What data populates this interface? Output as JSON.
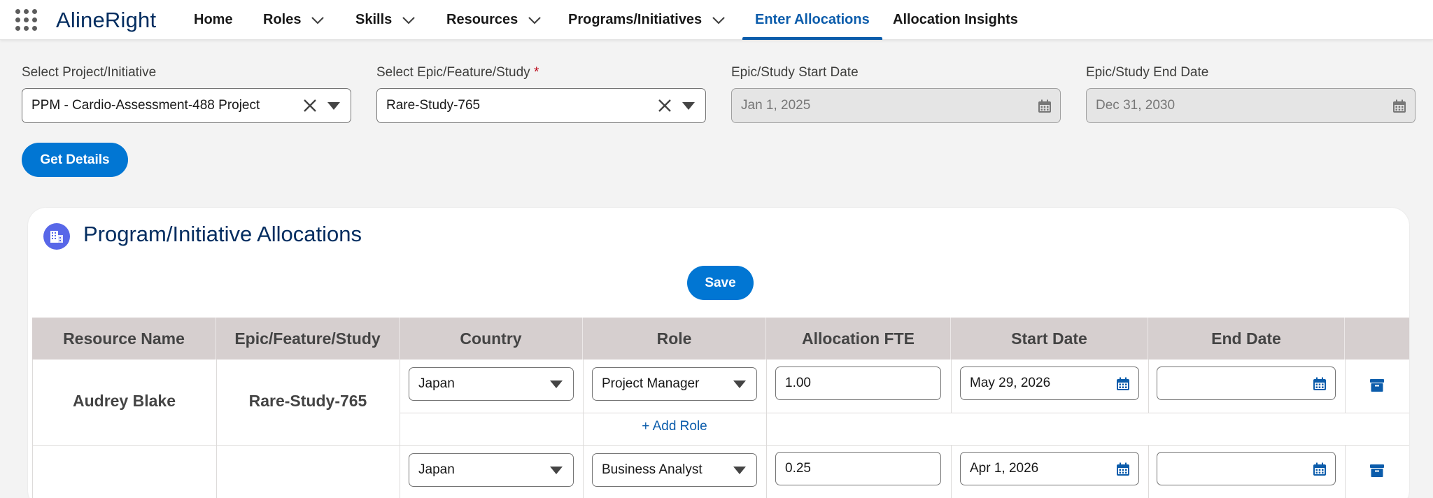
{
  "app": {
    "name": "AlineRight"
  },
  "nav": {
    "items": [
      {
        "label": "Home",
        "has_menu": false
      },
      {
        "label": "Roles",
        "has_menu": true
      },
      {
        "label": "Skills",
        "has_menu": true
      },
      {
        "label": "Resources",
        "has_menu": true
      },
      {
        "label": "Programs/Initiatives",
        "has_menu": true
      },
      {
        "label": "Enter Allocations",
        "has_menu": false,
        "active": true
      },
      {
        "label": "Allocation Insights",
        "has_menu": false
      }
    ]
  },
  "filters": {
    "project": {
      "label": "Select Project/Initiative",
      "value": "PPM - Cardio-Assessment-488 Project"
    },
    "epic": {
      "label": "Select Epic/Feature/Study",
      "required_mark": "*",
      "value": "Rare-Study-765"
    },
    "start_date": {
      "label": "Epic/Study Start Date",
      "value": "Jan 1, 2025"
    },
    "end_date": {
      "label": "Epic/Study End Date",
      "value": "Dec 31, 2030"
    },
    "get_details_label": "Get Details"
  },
  "card": {
    "title": "Program/Initiative Allocations",
    "icon": "building-icon",
    "save_label": "Save"
  },
  "table": {
    "columns": [
      "Resource Name",
      "Epic/Feature/Study",
      "Country",
      "Role",
      "Allocation FTE",
      "Start Date",
      "End Date"
    ],
    "rows": [
      {
        "resource_name": "Audrey Blake",
        "epic": "Rare-Study-765",
        "country": "Japan",
        "role": "Project Manager",
        "fte": "1.00",
        "start_date": "May 29, 2026",
        "end_date": "",
        "add_role_label": "+ Add Role"
      },
      {
        "resource_name": "",
        "epic": "",
        "country": "Japan",
        "role": "Business Analyst",
        "fte": "0.25",
        "start_date": "Apr 1, 2026",
        "end_date": ""
      }
    ]
  },
  "colors": {
    "brand": "#0176d3",
    "nav_active": "#0b5cab",
    "title_navy": "#032d60",
    "table_header_bg": "#d6cfcf",
    "card_icon_bg": "#5867e8"
  }
}
